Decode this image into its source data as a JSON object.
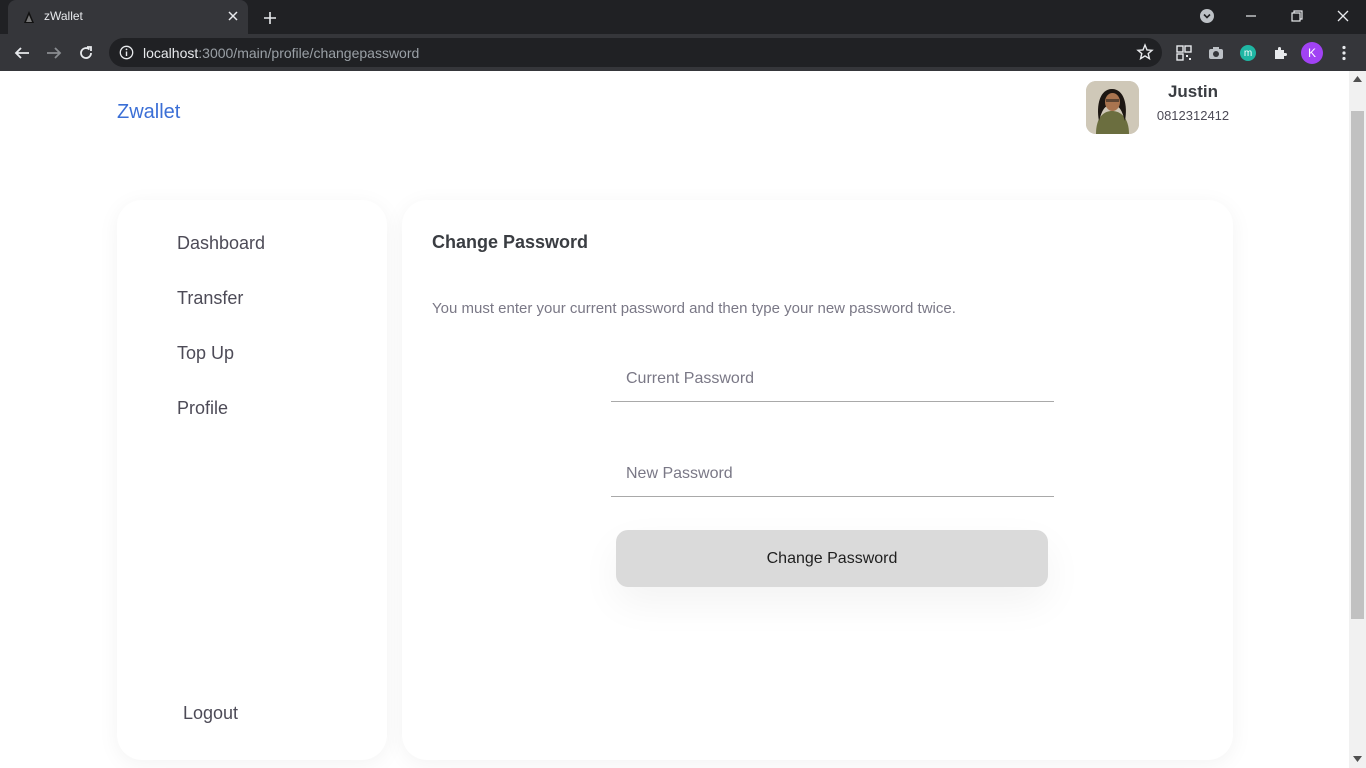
{
  "browser": {
    "tab_title": "zWallet",
    "url_host": "localhost",
    "url_rest": ":3000/main/profile/changepassword",
    "profile_initial": "K",
    "extension_letter": "m"
  },
  "app": {
    "brand": "Zwallet",
    "user": {
      "name": "Justin",
      "phone": "0812312412"
    }
  },
  "sidebar": {
    "items": [
      {
        "label": "Dashboard"
      },
      {
        "label": "Transfer"
      },
      {
        "label": "Top Up"
      },
      {
        "label": "Profile"
      }
    ],
    "logout_label": "Logout"
  },
  "main": {
    "title": "Change Password",
    "description": "You must enter your current password and then type your new password twice.",
    "current_password_placeholder": "Current Password",
    "new_password_placeholder": "New Password",
    "submit_label": "Change Password"
  },
  "colors": {
    "brand": "#3b6fd6",
    "button_bg": "#dadada",
    "text_primary": "#3a3d42",
    "text_secondary": "#7a7886"
  }
}
